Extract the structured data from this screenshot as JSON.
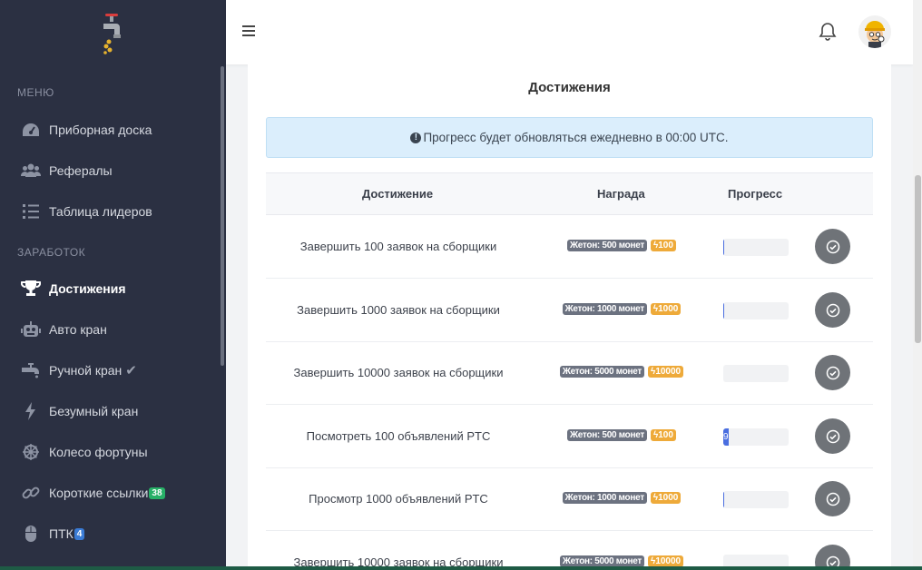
{
  "sidebar": {
    "section_menu": "МЕНЮ",
    "section_earnings": "ЗАРАБОТОК",
    "items": [
      {
        "label": "Приборная доска",
        "icon": "dashboard-icon"
      },
      {
        "label": "Рефералы",
        "icon": "users-icon"
      },
      {
        "label": "Таблица лидеров",
        "icon": "list-icon"
      },
      {
        "label": "Достижения",
        "icon": "trophy-icon",
        "active": true
      },
      {
        "label": "Авто кран",
        "icon": "robot-icon"
      },
      {
        "label": "Ручной кран",
        "icon": "faucet-icon",
        "suffix": "✔"
      },
      {
        "label": "Безумный кран",
        "icon": "bolt-icon"
      },
      {
        "label": "Колесо фортуны",
        "icon": "wheel-icon"
      },
      {
        "label": "Короткие ссылки",
        "icon": "link-icon",
        "badge": "38"
      },
      {
        "label": "ПТК",
        "icon": "mouse-icon",
        "badge": "4"
      }
    ]
  },
  "card": {
    "title": "Достижения",
    "alert": "Прогресс будет обновляться ежедневно в 00:00 UTC.",
    "alert_icon": "!",
    "columns": [
      "Достижение",
      "Награда",
      "Прогресс"
    ]
  },
  "rows": [
    {
      "name": "Завершить 100 заявок на сборщики",
      "token": "Жетон: 500 монет",
      "energy": "100",
      "progress": 0.01,
      "progress_label": ""
    },
    {
      "name": "Завершить 1000 заявок на сборщики",
      "token": "Жетон: 1000 монет",
      "energy": "1000",
      "progress": 0.01,
      "progress_label": ""
    },
    {
      "name": "Завершить 10000 заявок на сборщики",
      "token": "Жетон: 5000 монет",
      "energy": "10000",
      "progress": 0.0,
      "progress_label": ""
    },
    {
      "name": "Посмотреть 100 объявлений PTC",
      "token": "Жетон: 500 монет",
      "energy": "100",
      "progress": 0.09,
      "progress_label": "9"
    },
    {
      "name": "Просмотр 1000 объявлений PTC",
      "token": "Жетон: 1000 монет",
      "energy": "1000",
      "progress": 0.01,
      "progress_label": ""
    },
    {
      "name": "Завершить 10000 заявок на сборщики",
      "token": "Жетон: 5000 монет",
      "energy": "10000",
      "progress": 0.0,
      "progress_label": ""
    }
  ]
}
